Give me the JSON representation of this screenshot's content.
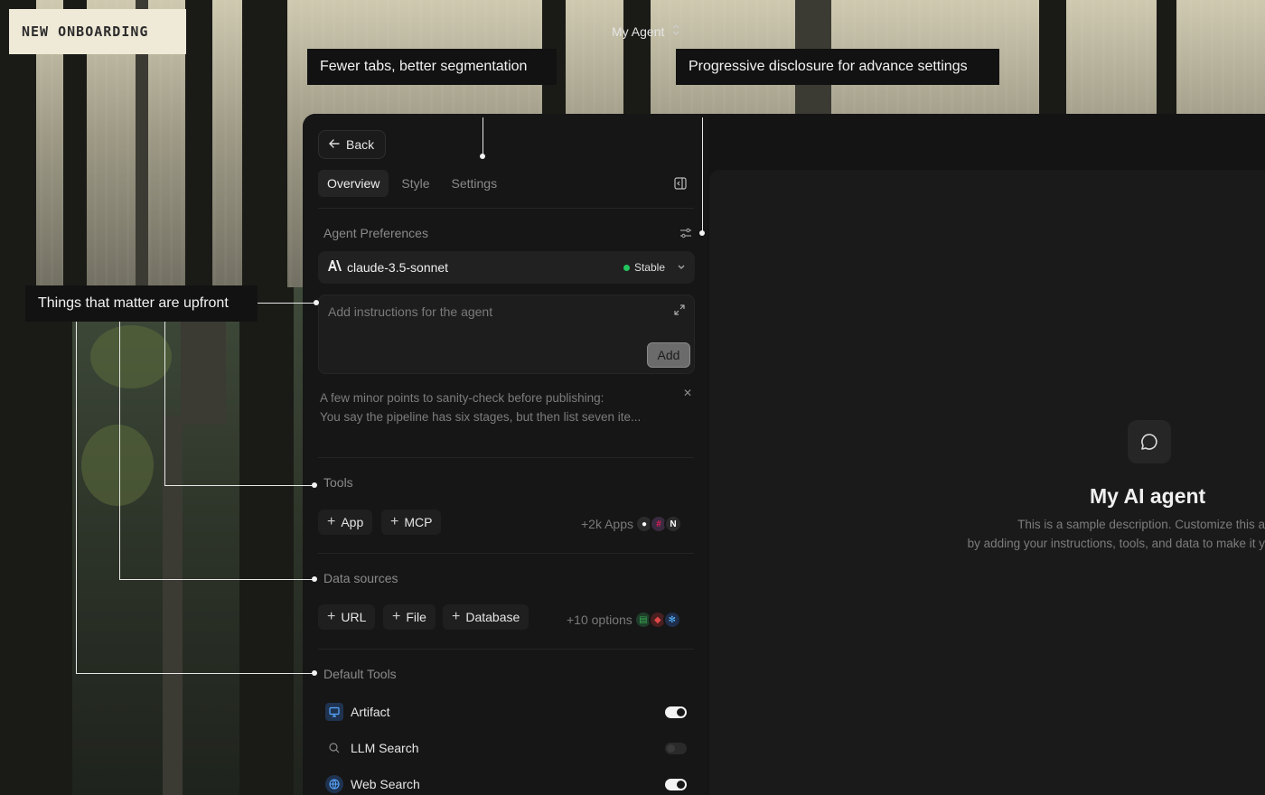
{
  "badge": {
    "text": "NEW ONBOARDING"
  },
  "callouts": {
    "tabs": "Fewer tabs, better segmentation",
    "disclosure": "Progressive disclosure for advance settings",
    "upfront": "Things that matter are upfront"
  },
  "header": {
    "back_label": "Back",
    "agent_name": "My Agent"
  },
  "tabs": [
    {
      "label": "Overview",
      "active": true
    },
    {
      "label": "Style",
      "active": false
    },
    {
      "label": "Settings",
      "active": false
    }
  ],
  "preferences": {
    "label": "Agent Preferences",
    "model": "claude-3.5-sonnet",
    "status": "Stable",
    "status_color": "#22c55e"
  },
  "instructions": {
    "placeholder": "Add instructions for the agent",
    "add_label": "Add"
  },
  "note": {
    "line1": "A few minor points to sanity-check before publishing:",
    "line2": "You say the pipeline has six stages, but then list seven ite..."
  },
  "tools": {
    "label": "Tools",
    "chips": [
      "App",
      "MCP"
    ],
    "more": "+2k Apps"
  },
  "data_sources": {
    "label": "Data sources",
    "chips": [
      "URL",
      "File",
      "Database"
    ],
    "more": "+10 options"
  },
  "default_tools": {
    "label": "Default Tools",
    "items": [
      {
        "label": "Artifact",
        "icon": "monitor-icon",
        "enabled": true
      },
      {
        "label": "LLM Search",
        "icon": "search-icon",
        "enabled": false
      },
      {
        "label": "Web Search",
        "icon": "globe-icon",
        "enabled": true
      }
    ]
  },
  "preview": {
    "title": "My AI agent",
    "desc_line1": "This is a sample description. Customize this a",
    "desc_line2": "by adding your instructions, tools, and data to make it y"
  },
  "colors": {
    "accent": "#f2f2f2",
    "panel": "#161616",
    "status_green": "#22c55e"
  }
}
